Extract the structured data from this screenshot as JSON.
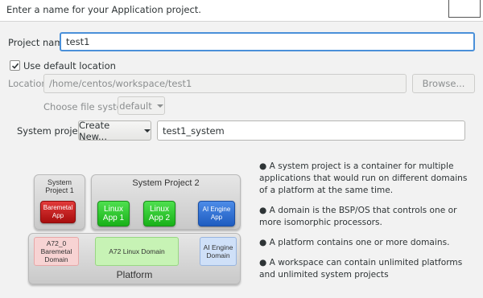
{
  "header": {
    "instruction": "Enter a name for your Application project."
  },
  "form": {
    "project_name_label": "Project name:",
    "project_name_value": "test1",
    "use_default_location_label": "Use default location",
    "use_default_location_checked": true,
    "location_label": "Location:",
    "location_value": "/home/centos/workspace/test1",
    "browse_label": "Browse...",
    "file_system_label": "Choose file system:",
    "file_system_value": "default",
    "system_project_label": "System project:",
    "create_new_label": "Create New...",
    "system_project_value": "test1_system"
  },
  "info_bullets": [
    "● A system project is a container for multiple applications that would run on different domains of a platform at the same time.",
    "● A domain is the BSP/OS that controls one or more isomorphic processors.",
    "● A platform contains one or more domains.",
    "● A workspace can contain unlimited platforms and unlimited system projects"
  ],
  "diagram": {
    "system_project_1": {
      "title": "System Project 1",
      "apps": [
        "Baremetal App"
      ]
    },
    "system_project_2": {
      "title": "System Project 2",
      "apps": [
        "Linux App 1",
        "Linux App 2",
        "AI Engine App"
      ]
    },
    "platform": {
      "title": "Platform",
      "domains": [
        "A72_0 Baremetal Domain",
        "A72 Linux Domain",
        "AI Engine Domain"
      ]
    }
  },
  "colors": {
    "focus_border": "#4a90d9",
    "baremetal": "#c41a1a",
    "linux": "#2ec52e",
    "ai_engine": "#2f6fd6"
  }
}
